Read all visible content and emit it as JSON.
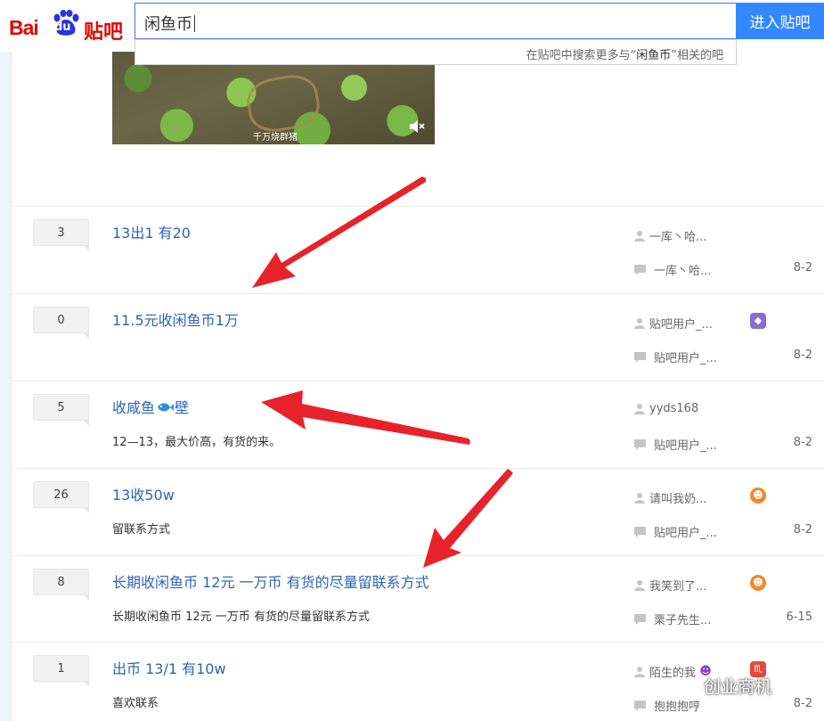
{
  "header": {
    "logo_text": "Bai du 贴吧",
    "logo_bai": "Bai",
    "logo_du": "du",
    "logo_tieba": "贴吧",
    "search_value": "闲鱼币",
    "search_button": "进入贴吧",
    "suggest_prefix": "在贴吧中搜索更多与“",
    "suggest_keyword": "闲鱼币",
    "suggest_suffix": "”相关的吧"
  },
  "video": {
    "caption": "千万烧群猪",
    "mute_icon": "mute-icon"
  },
  "threads": [
    {
      "replies": "3",
      "title": "13出1 有20",
      "abstract": "",
      "author": "一库丶哈...",
      "last_reply": "一库丶哈...",
      "date": "8-2",
      "badge": ""
    },
    {
      "replies": "0",
      "title": "11.5元收闲鱼币1万",
      "abstract": "",
      "author": "贴吧用户_...",
      "last_reply": "贴吧用户_...",
      "date": "8-2",
      "badge": "purple"
    },
    {
      "replies": "5",
      "title_pre": "收咸鱼",
      "title_post": "壁",
      "abstract": "12—13，最大价高，有货的来。",
      "author": "yyds168",
      "last_reply": "贴吧用户_...",
      "date": "8-2",
      "badge": ""
    },
    {
      "replies": "26",
      "title": "13收50w",
      "abstract": "留联系方式",
      "author": "请叫我奶...",
      "last_reply": "贴吧用户_...",
      "date": "8-2",
      "badge": "orange"
    },
    {
      "replies": "8",
      "title": "长期收闲鱼币 12元 一万币 有货的尽量留联系方式",
      "abstract": "长期收闲鱼币 12元 一万币 有货的尽量留联系方式",
      "author": "我笑到了...",
      "last_reply": "栗子先生...",
      "date": "6-15",
      "badge": "orange"
    },
    {
      "replies": "1",
      "title": "出币 13/1 有10w",
      "abstract": "喜欢联系",
      "author": "陌生的我",
      "last_reply": "抱抱抱哼",
      "date": "8-2",
      "badge": "red"
    }
  ],
  "watermark": "创业商机",
  "colors": {
    "link": "#2d64b3",
    "accent": "#3388ff",
    "brand_red": "#e10601",
    "arrow": "#e8222a"
  }
}
